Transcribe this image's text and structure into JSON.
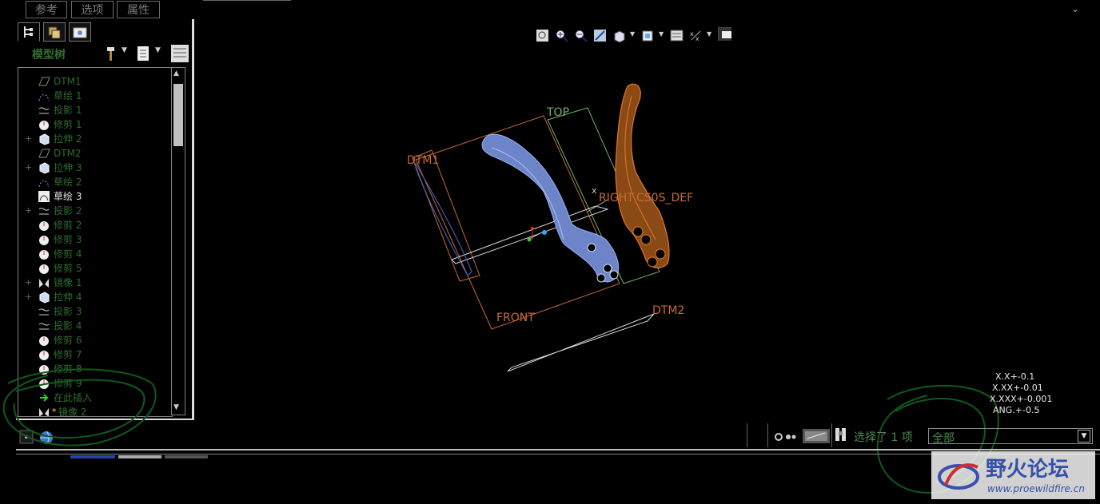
{
  "top_tabs": [
    "参考",
    "选项",
    "属性"
  ],
  "panel": {
    "title": "模型树",
    "tree_items": [
      {
        "label": "DTM1",
        "plus": "",
        "icon": "datum-plane-icon"
      },
      {
        "label": "草绘 1",
        "plus": "",
        "icon": "sketch-icon"
      },
      {
        "label": "投影 1",
        "plus": "",
        "icon": "projection-icon"
      },
      {
        "label": "修剪 1",
        "plus": "",
        "icon": "trim-icon"
      },
      {
        "label": "拉伸 2",
        "plus": "+",
        "icon": "extrude-icon"
      },
      {
        "label": "DTM2",
        "plus": "",
        "icon": "datum-plane-icon"
      },
      {
        "label": "拉伸 3",
        "plus": "+",
        "icon": "extrude-icon"
      },
      {
        "label": "草绘 2",
        "plus": "",
        "icon": "sketch-icon"
      },
      {
        "label": "草绘 3",
        "plus": "",
        "icon": "sketch-active-icon",
        "highlight": true
      },
      {
        "label": "投影 2",
        "plus": "+",
        "icon": "projection-icon"
      },
      {
        "label": "修剪 2",
        "plus": "",
        "icon": "trim-icon"
      },
      {
        "label": "修剪 3",
        "plus": "",
        "icon": "trim-icon"
      },
      {
        "label": "修剪 4",
        "plus": "",
        "icon": "trim-icon"
      },
      {
        "label": "修剪 5",
        "plus": "",
        "icon": "trim-icon"
      },
      {
        "label": "镜像 1",
        "plus": "+",
        "icon": "mirror-icon"
      },
      {
        "label": "拉伸 4",
        "plus": "+",
        "icon": "extrude-icon"
      },
      {
        "label": "投影 3",
        "plus": "",
        "icon": "projection-icon"
      },
      {
        "label": "投影 4",
        "plus": "",
        "icon": "projection-icon"
      },
      {
        "label": "修剪 6",
        "plus": "",
        "icon": "trim-icon"
      },
      {
        "label": "修剪 7",
        "plus": "",
        "icon": "trim-icon"
      },
      {
        "label": "修剪 8",
        "plus": "",
        "icon": "trim-icon"
      },
      {
        "label": "修剪 9",
        "plus": "",
        "icon": "trim-icon"
      },
      {
        "label": "在此插入",
        "plus": "",
        "icon": "insert-here-arrow-icon"
      },
      {
        "label": "镜像 2",
        "plus": "",
        "icon": "mirror-icon",
        "star": "*"
      }
    ]
  },
  "viewport": {
    "datum_labels": {
      "top": "TOP",
      "dtm1": "DTM1",
      "right": "RIGHT",
      "csys": "CS0S_DEF",
      "front": "FRONT",
      "dtm2": "DTM2"
    },
    "csys_axis_label": "x"
  },
  "tolerances": [
    "X.X+-0.1",
    "X.XX+-0.01",
    "X.XXX+-0.001",
    "ANG.+-0.5"
  ],
  "status": {
    "selection_text": "选择了 1 项",
    "filter_value": "全部"
  },
  "watermark": {
    "title": "野火论坛",
    "url": "www.proewildfire.cn"
  },
  "colors": {
    "tree_text": "#2f6d2f",
    "datum_text": "#c56a3a",
    "blade_blue": "#7a92d6",
    "blade_orange": "#e07a2a",
    "annotation_green": "#0f5a1e"
  }
}
